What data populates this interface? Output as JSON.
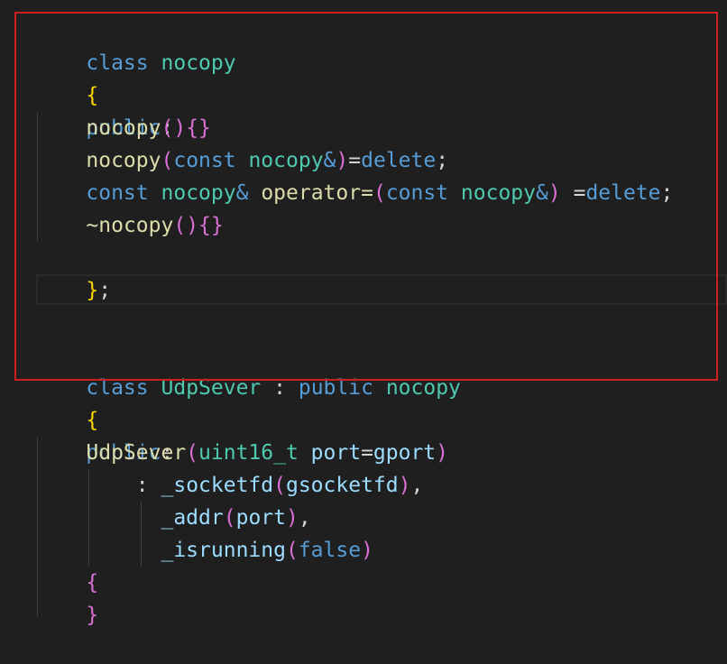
{
  "code": {
    "l1": {
      "kw": "class",
      "name": "nocopy"
    },
    "l2": {
      "brace": "{"
    },
    "l3": {
      "access": "public",
      "colon": ":"
    },
    "l4": {
      "name": "nocopy",
      "parens": "()",
      "braces": "{}"
    },
    "l5": {
      "name": "nocopy",
      "open": "(",
      "kw": "const",
      "type": "nocopy",
      "amp": "&",
      "close": ")",
      "assign": "=",
      "del": "delete",
      "semi": ";"
    },
    "l6": {
      "kw": "const",
      "type": "nocopy",
      "amp": "&",
      "op": "operator",
      "eq": "=",
      "open": "(",
      "kw2": "const",
      "type2": "nocopy",
      "amp2": "&",
      "close": ")",
      "assign": " =",
      "del": "delete",
      "semi": ";"
    },
    "l7": {
      "tilde": "~",
      "name": "nocopy",
      "parens": "()",
      "braces": "{}"
    },
    "l8": {
      "brace": "}",
      "semi": ";"
    },
    "l11": {
      "kw": "class",
      "name": "UdpSever",
      "colon": ":",
      "access": "public",
      "base": "nocopy"
    },
    "l12": {
      "brace": "{"
    },
    "l13": {
      "access": "public",
      "colon": ":"
    },
    "l14": {
      "name": "UdpSever",
      "open": "(",
      "type": "uint16_t",
      "param": "port",
      "eq": "=",
      "def": "gport",
      "close": ")"
    },
    "l15": {
      "colon": ":",
      "member": "_socketfd",
      "open": "(",
      "arg": "gsocketfd",
      "close": ")",
      "comma": ","
    },
    "l16": {
      "member": "_addr",
      "open": "(",
      "arg": "port",
      "close": ")",
      "comma": ","
    },
    "l17": {
      "member": "_isrunning",
      "open": "(",
      "arg": "false",
      "close": ")"
    },
    "l18": {
      "brace": "{"
    },
    "l19": {
      "brace": "}"
    }
  },
  "colors": {
    "background": "#1f1f1f",
    "keyword": "#569cd6",
    "type": "#4ec9b0",
    "function": "#dcdcaa",
    "identifier": "#9cdcfe",
    "bracket1": "#ffd700",
    "bracket2": "#da70d6",
    "bracket3": "#179fff",
    "selection_box": "#cc1f1f"
  }
}
